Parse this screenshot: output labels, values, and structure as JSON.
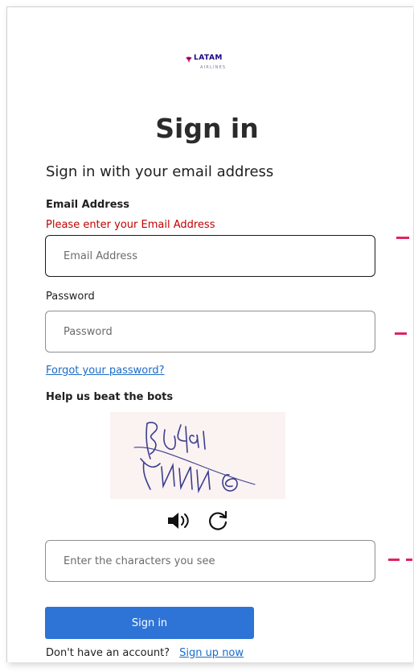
{
  "brand": {
    "name": "LATAM",
    "sub": "AIRLINES",
    "accent": "#1b0088",
    "mark_color": "#e8114b"
  },
  "page": {
    "title": "Sign in",
    "subtitle": "Sign in with your email address"
  },
  "email": {
    "label": "Email Address",
    "error": "Please enter your Email Address",
    "placeholder": "Email Address",
    "value": ""
  },
  "password": {
    "label": "Password",
    "placeholder": "Password",
    "value": ""
  },
  "forgot_link": "Forgot your password?",
  "captcha": {
    "label": "Help us beat the bots",
    "input_placeholder": "Enter the characters you see",
    "audio_icon": "speaker-icon",
    "refresh_icon": "refresh-icon"
  },
  "submit": {
    "label": "Sign in",
    "color": "#2e74d6"
  },
  "footer": {
    "prompt": "Don't have an account?",
    "link": "Sign up now"
  },
  "colors": {
    "error": "#c20000",
    "link": "#1a6bc7",
    "marker": "#e0245e"
  }
}
